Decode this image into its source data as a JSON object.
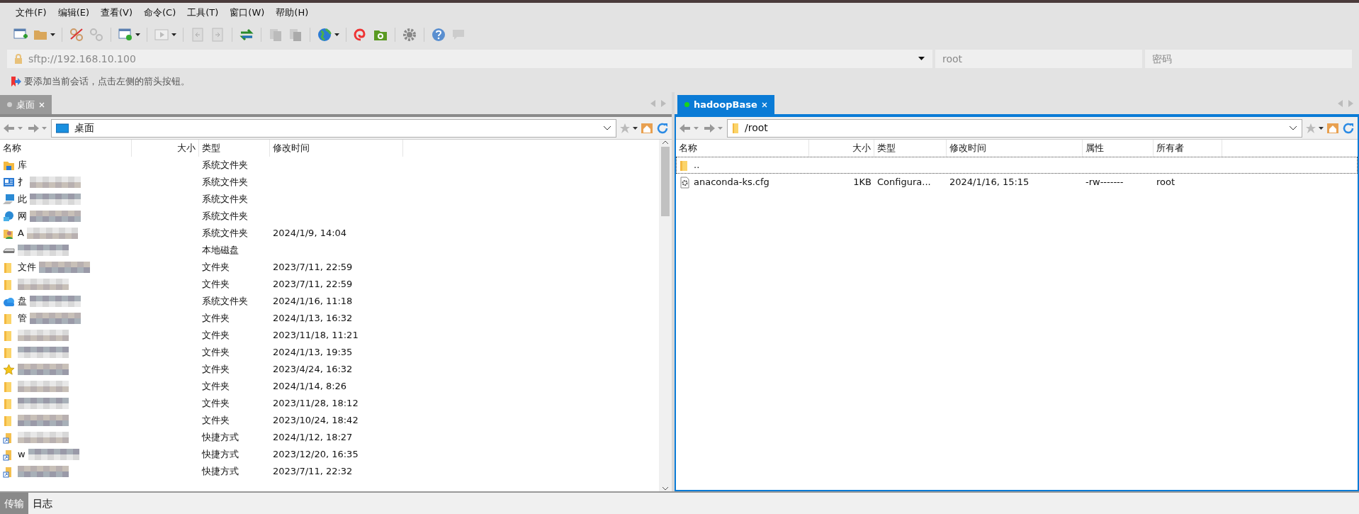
{
  "menu": [
    "文件(F)",
    "编辑(E)",
    "查看(V)",
    "命令(C)",
    "工具(T)",
    "窗口(W)",
    "帮助(H)"
  ],
  "address": {
    "placeholder": "sftp://192.168.10.100"
  },
  "user": {
    "placeholder": "root"
  },
  "password": {
    "placeholder": "密码"
  },
  "hint": "要添加当前会话，点击左侧的箭头按钮。",
  "left": {
    "tab": {
      "label": "桌面",
      "selected": false,
      "connected": false
    },
    "path": "桌面",
    "columns": [
      "名称",
      "大小",
      "类型",
      "修改时间"
    ],
    "rows": [
      {
        "kind": "library",
        "name": "库",
        "redacted": false,
        "type": "系统文件夹"
      },
      {
        "kind": "panel",
        "name": "扌",
        "redacted": true,
        "type": "系统文件夹"
      },
      {
        "kind": "computer",
        "name": "此",
        "redacted": true,
        "type": "系统文件夹"
      },
      {
        "kind": "network",
        "name": "网",
        "redacted": true,
        "type": "系统文件夹"
      },
      {
        "kind": "user",
        "name": "A",
        "redacted": true,
        "type": "系统文件夹",
        "modified": "2024/1/9, 14:04"
      },
      {
        "kind": "drive",
        "redacted": true,
        "type": "本地磁盘"
      },
      {
        "kind": "folder",
        "name": "文件",
        "redacted": true,
        "type": "文件夹",
        "modified": "2023/7/11, 22:59"
      },
      {
        "kind": "folder",
        "redacted": true,
        "type": "文件夹",
        "modified": "2023/7/11, 22:59"
      },
      {
        "kind": "cloud",
        "name": "盘",
        "redacted": true,
        "type": "系统文件夹",
        "modified": "2024/1/16, 11:18"
      },
      {
        "kind": "folder",
        "name": "管",
        "redacted": true,
        "type": "文件夹",
        "modified": "2024/1/13, 16:32"
      },
      {
        "kind": "folder",
        "redacted": true,
        "type": "文件夹",
        "modified": "2023/11/18, 11:21"
      },
      {
        "kind": "folder",
        "redacted": true,
        "type": "文件夹",
        "modified": "2024/1/13, 19:35"
      },
      {
        "kind": "star",
        "redacted": true,
        "type": "文件夹",
        "modified": "2023/4/24, 16:32"
      },
      {
        "kind": "folder",
        "redacted": true,
        "type": "文件夹",
        "modified": "2024/1/14, 8:26"
      },
      {
        "kind": "folder",
        "redacted": true,
        "type": "文件夹",
        "modified": "2023/11/28, 18:12"
      },
      {
        "kind": "folder",
        "redacted": true,
        "type": "文件夹",
        "modified": "2023/10/24, 18:42"
      },
      {
        "kind": "shortcut",
        "redacted": true,
        "type": "快捷方式",
        "modified": "2024/1/12, 18:27"
      },
      {
        "kind": "shortcut",
        "name": "w",
        "redacted": true,
        "type": "快捷方式",
        "modified": "2023/12/20, 16:35"
      },
      {
        "kind": "shortcut",
        "redacted": true,
        "type": "快捷方式",
        "modified": "2023/7/11, 22:32"
      }
    ]
  },
  "right": {
    "tab": {
      "label": "hadoopBase",
      "selected": true,
      "connected": true
    },
    "path": "/root",
    "columns": [
      "名称",
      "大小",
      "类型",
      "修改时间",
      "属性",
      "所有者"
    ],
    "rows": [
      {
        "kind": "folder",
        "name": "..",
        "focused": true
      },
      {
        "kind": "file",
        "name": "anaconda-ks.cfg",
        "focused": false,
        "size": "1KB",
        "type": "Configura...",
        "modified": "2024/1/16, 15:15",
        "attributes": "-rw-------",
        "owner": "root"
      }
    ]
  },
  "bottom_tabs": [
    {
      "label": "传输",
      "selected": true
    },
    {
      "label": "日志",
      "selected": false
    }
  ]
}
